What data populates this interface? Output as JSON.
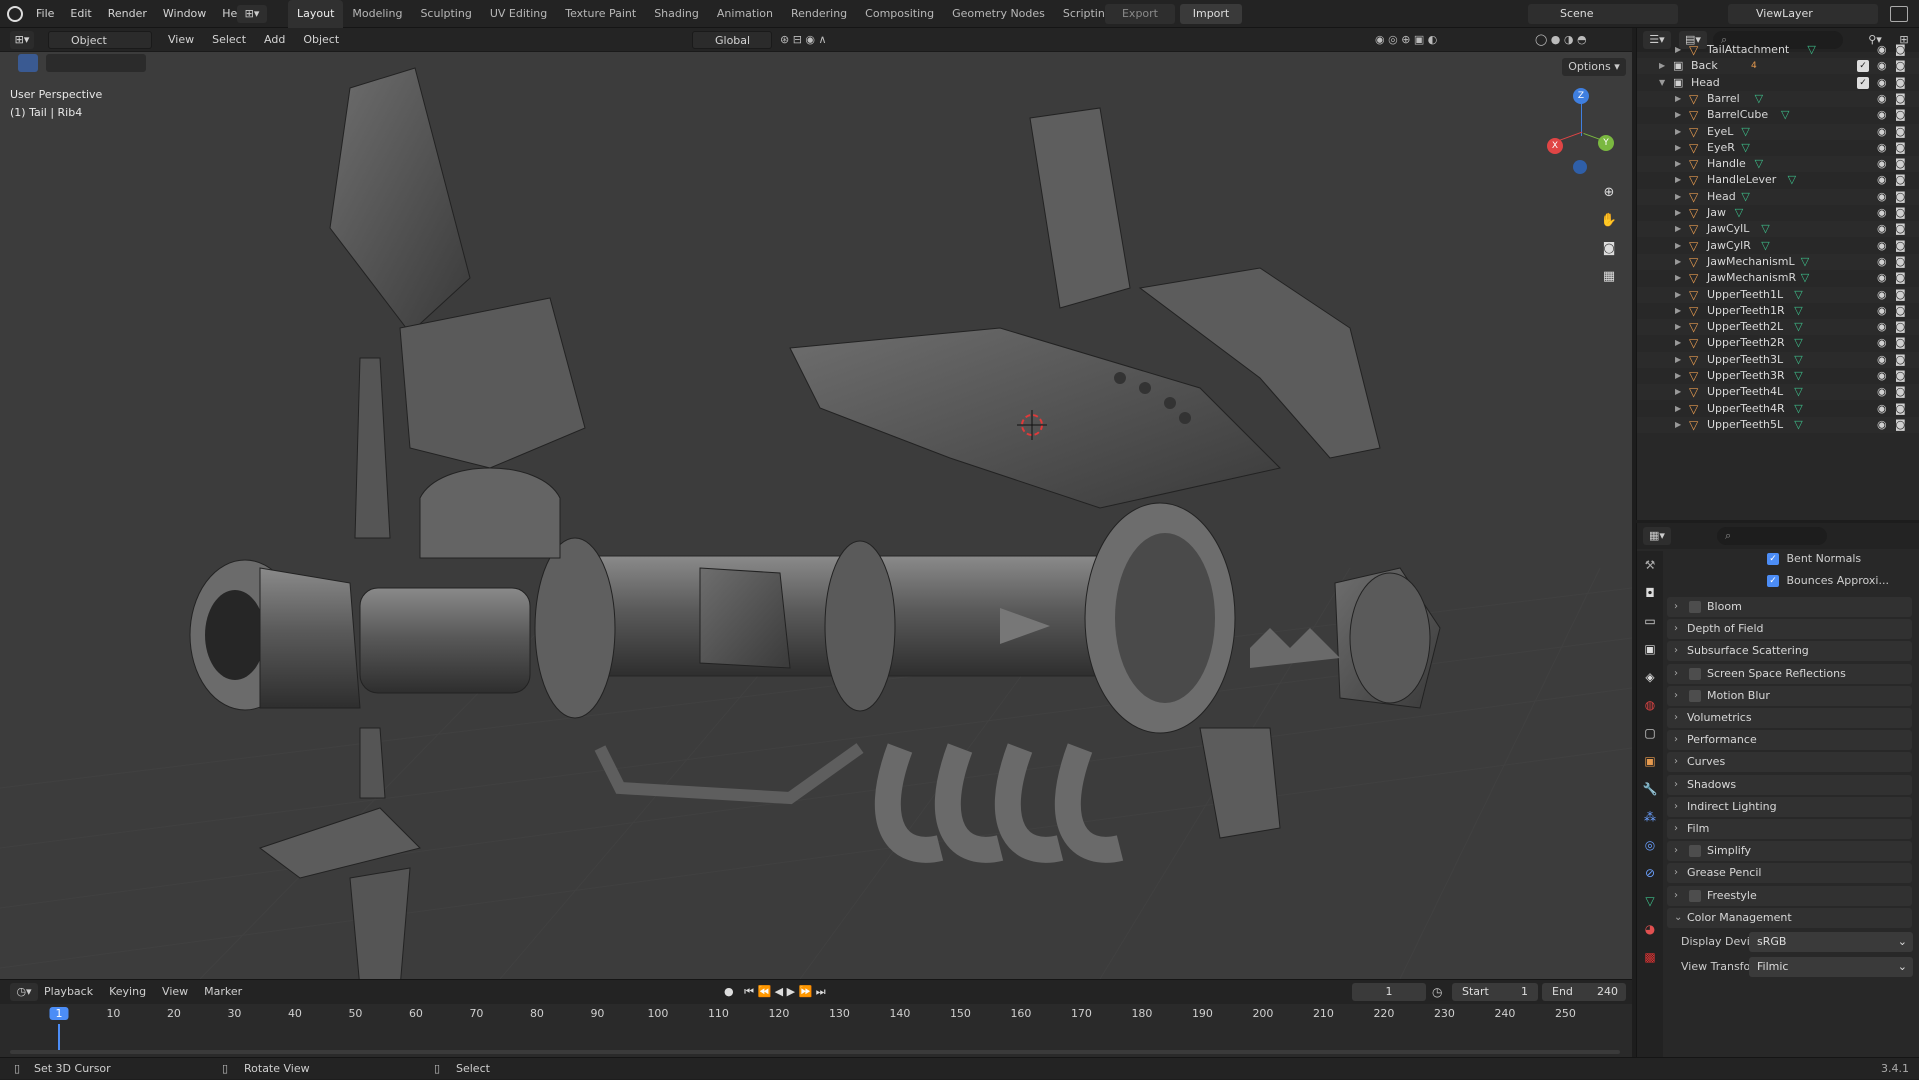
{
  "top_menu": [
    "File",
    "Edit",
    "Render",
    "Window",
    "Help"
  ],
  "workspace_tabs": [
    "Layout",
    "Modeling",
    "Sculpting",
    "UV Editing",
    "Texture Paint",
    "Shading",
    "Animation",
    "Rendering",
    "Compositing",
    "Geometry Nodes",
    "Scripting"
  ],
  "active_tab": "Layout",
  "add_tab_symbol": "+",
  "export_label": "Export",
  "import_label": "Import",
  "scene_name": "Scene",
  "view_layer": "ViewLayer",
  "viewport": {
    "mode": "Object Mode",
    "menus": [
      "View",
      "Select",
      "Add",
      "Object"
    ],
    "transform_orientation": "Global",
    "options_label": "Options",
    "perspective_label": "User Perspective",
    "active_object": "(1) Tail | Rib4",
    "gizmo_axes": {
      "x": "X",
      "y": "Y",
      "z": "Z"
    }
  },
  "outliner": {
    "rows": [
      {
        "label": "TailAttachment",
        "indent": 3,
        "expanded": false,
        "checkbox": false,
        "mesh": true
      },
      {
        "label": "Back",
        "indent": 2,
        "expanded": false,
        "checkbox": true,
        "mesh": false,
        "badge": "4"
      },
      {
        "label": "Head",
        "indent": 2,
        "expanded": true,
        "checkbox": true,
        "mesh": false
      },
      {
        "label": "Barrel",
        "indent": 3,
        "expanded": false,
        "checkbox": false,
        "mesh": true
      },
      {
        "label": "BarrelCube",
        "indent": 3,
        "expanded": false,
        "checkbox": false,
        "mesh": true
      },
      {
        "label": "EyeL",
        "indent": 3,
        "expanded": false,
        "checkbox": false,
        "mesh": true
      },
      {
        "label": "EyeR",
        "indent": 3,
        "expanded": false,
        "checkbox": false,
        "mesh": true
      },
      {
        "label": "Handle",
        "indent": 3,
        "expanded": false,
        "checkbox": false,
        "mesh": true
      },
      {
        "label": "HandleLever",
        "indent": 3,
        "expanded": false,
        "checkbox": false,
        "mesh": true
      },
      {
        "label": "Head",
        "indent": 3,
        "expanded": false,
        "checkbox": false,
        "mesh": true
      },
      {
        "label": "Jaw",
        "indent": 3,
        "expanded": false,
        "checkbox": false,
        "mesh": true
      },
      {
        "label": "JawCylL",
        "indent": 3,
        "expanded": false,
        "checkbox": false,
        "mesh": true
      },
      {
        "label": "JawCylR",
        "indent": 3,
        "expanded": false,
        "checkbox": false,
        "mesh": true
      },
      {
        "label": "JawMechanismL",
        "indent": 3,
        "expanded": false,
        "checkbox": false,
        "mesh": true
      },
      {
        "label": "JawMechanismR",
        "indent": 3,
        "expanded": false,
        "checkbox": false,
        "mesh": true
      },
      {
        "label": "UpperTeeth1L",
        "indent": 3,
        "expanded": false,
        "checkbox": false,
        "mesh": true
      },
      {
        "label": "UpperTeeth1R",
        "indent": 3,
        "expanded": false,
        "checkbox": false,
        "mesh": true
      },
      {
        "label": "UpperTeeth2L",
        "indent": 3,
        "expanded": false,
        "checkbox": false,
        "mesh": true
      },
      {
        "label": "UpperTeeth2R",
        "indent": 3,
        "expanded": false,
        "checkbox": false,
        "mesh": true
      },
      {
        "label": "UpperTeeth3L",
        "indent": 3,
        "expanded": false,
        "checkbox": false,
        "mesh": true
      },
      {
        "label": "UpperTeeth3R",
        "indent": 3,
        "expanded": false,
        "checkbox": false,
        "mesh": true
      },
      {
        "label": "UpperTeeth4L",
        "indent": 3,
        "expanded": false,
        "checkbox": false,
        "mesh": true
      },
      {
        "label": "UpperTeeth4R",
        "indent": 3,
        "expanded": false,
        "checkbox": false,
        "mesh": true
      },
      {
        "label": "UpperTeeth5L",
        "indent": 3,
        "expanded": false,
        "checkbox": false,
        "mesh": true
      }
    ]
  },
  "properties": {
    "checkbox_items": [
      "Bent Normals",
      "Bounces Approxi..."
    ],
    "panels": [
      {
        "label": "Bloom",
        "checkbox": true
      },
      {
        "label": "Depth of Field",
        "checkbox": false
      },
      {
        "label": "Subsurface Scattering",
        "checkbox": false
      },
      {
        "label": "Screen Space Reflections",
        "checkbox": true
      },
      {
        "label": "Motion Blur",
        "checkbox": true
      },
      {
        "label": "Volumetrics",
        "checkbox": false
      },
      {
        "label": "Performance",
        "checkbox": false
      },
      {
        "label": "Curves",
        "checkbox": false
      },
      {
        "label": "Shadows",
        "checkbox": false
      },
      {
        "label": "Indirect Lighting",
        "checkbox": false
      },
      {
        "label": "Film",
        "checkbox": false
      },
      {
        "label": "Simplify",
        "checkbox": true
      },
      {
        "label": "Grease Pencil",
        "checkbox": false
      },
      {
        "label": "Freestyle",
        "checkbox": true
      }
    ],
    "color_management": {
      "label": "Color Management",
      "display_device_label": "Display Device",
      "display_device": "sRGB",
      "view_transform_label": "View Transform",
      "view_transform": "Filmic"
    }
  },
  "timeline": {
    "menus": [
      "Playback",
      "Keying",
      "View",
      "Marker"
    ],
    "current_frame": "1",
    "start_label": "Start",
    "start": "1",
    "end_label": "End",
    "end": "240",
    "ticks": [
      "1",
      "10",
      "20",
      "30",
      "40",
      "50",
      "60",
      "70",
      "80",
      "90",
      "100",
      "110",
      "120",
      "130",
      "140",
      "150",
      "160",
      "170",
      "180",
      "190",
      "200",
      "210",
      "220",
      "230",
      "240",
      "250"
    ]
  },
  "status_bar": {
    "left": "Set 3D Cursor",
    "middle": "Rotate View",
    "right": "Select",
    "version": "3.4.1"
  },
  "colors": {
    "accent": "#4c8df6",
    "object_orange": "#e59a4f",
    "mesh_green": "#3dbf8a",
    "axis_x": "#e04545",
    "axis_y": "#7ab840",
    "axis_z": "#3f7fe0"
  }
}
